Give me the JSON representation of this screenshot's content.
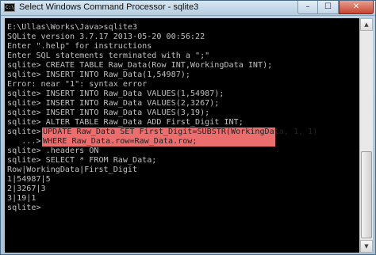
{
  "window": {
    "title": "Select Windows Command Processor - sqlite3",
    "icon": "cmd-icon",
    "icon_glyph": "C:\\",
    "controls": {
      "minimize": "–",
      "maximize": "☐",
      "close": "✕"
    }
  },
  "console": {
    "lines": [
      "E:\\Ullas\\Works\\Java>sqlite3",
      "SQLite version 3.7.17 2013-05-20 00:56:22",
      "Enter \".help\" for instructions",
      "Enter SQL statements terminated with a \";\"",
      "sqlite> CREATE TABLE Raw_Data(Row INT,WorkingData INT);",
      "sqlite> INSERT INTO Raw_Data(1,54987);",
      "Error: near \"1\": syntax error",
      "sqlite> INSERT INTO Raw_Data VALUES(1,54987);",
      "sqlite> INSERT INTO Raw_Data VALUES(2,3267);",
      "sqlite> INSERT INTO Raw_Data VALUES(3,19);",
      "sqlite> ALTER TABLE Raw_Data ADD First_Digit INT;",
      "sqlite> ",
      "   ...> ",
      "sqlite> .headers ON",
      "sqlite> SELECT * FROM Raw_Data;",
      "Row|WorkingData|First_Digit",
      "1|54987|5",
      "2|3267|3",
      "3|19|1",
      "sqlite>"
    ],
    "highlighted": [
      "UPDATE Raw_Data SET First_Digit=SUBSTR(WorkingData, 1, 1)",
      "WHERE Raw_Data.row=Raw_Data.row;"
    ],
    "highlight_color": "#ec6d6d",
    "text_color": "#c0c0c0",
    "background": "#000000"
  },
  "scrollbar": {
    "up_arrow": "▲",
    "down_arrow": "▼"
  }
}
